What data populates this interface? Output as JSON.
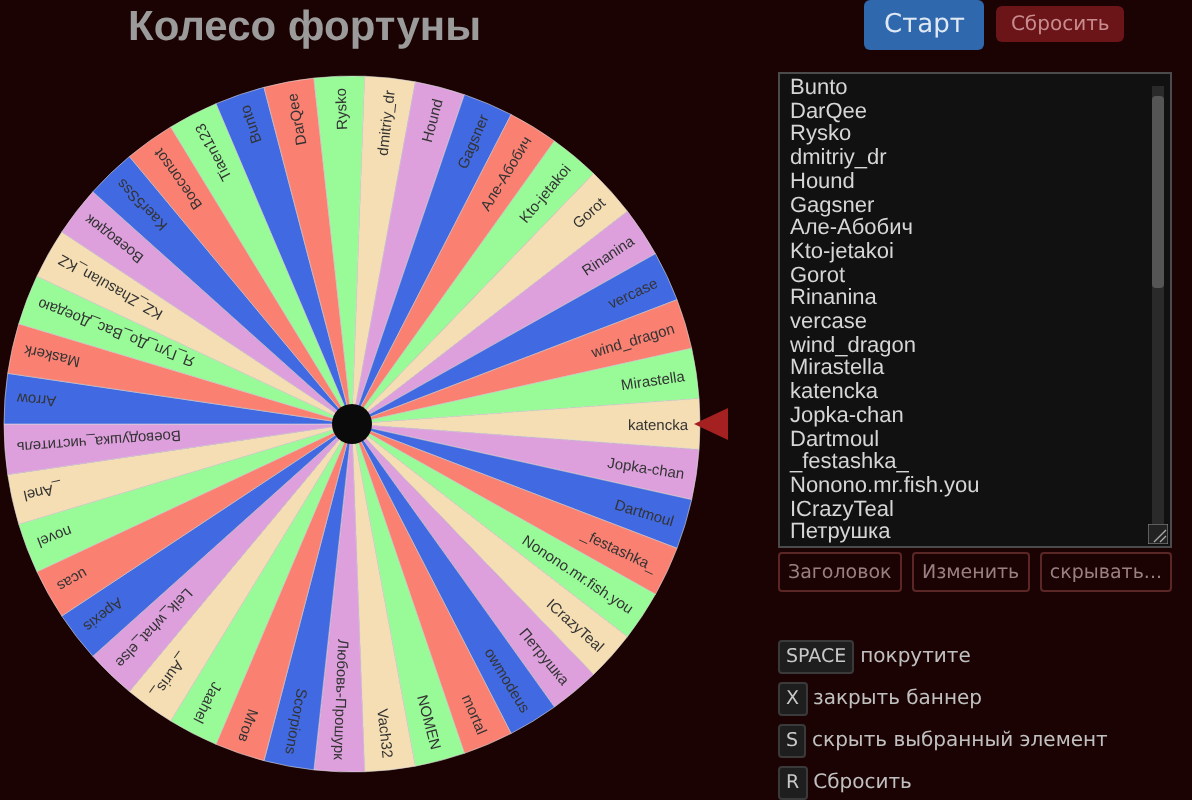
{
  "title": "Колесо фортуны",
  "buttons": [
    {
      "label": "Старт",
      "kind": "primary"
    },
    {
      "label": "Сбросить",
      "kind": "danger"
    }
  ],
  "wheel": {
    "segments": [
      {
        "label": "Bunto"
      },
      {
        "label": "DarQee"
      },
      {
        "label": "Rysko"
      },
      {
        "label": "dmitriy_dr"
      },
      {
        "label": "Hound"
      },
      {
        "label": "Gagsner"
      },
      {
        "label": "Але-Абобич"
      },
      {
        "label": "Kto-jetakoi"
      },
      {
        "label": "Gorot"
      },
      {
        "label": "Rinanina"
      },
      {
        "label": "vercase"
      },
      {
        "label": "wind_dragon"
      },
      {
        "label": "Mirastella"
      },
      {
        "label": "katencka"
      },
      {
        "label": "Jopka-chan"
      },
      {
        "label": "Dartmoul"
      },
      {
        "label": "_festashka_"
      },
      {
        "label": "Nonono.mr.fish.you"
      },
      {
        "label": "ICrazyTeal"
      },
      {
        "label": "Петрушка"
      },
      {
        "label": "owmodeus"
      },
      {
        "label": "mortal"
      },
      {
        "label": "NOMEN"
      },
      {
        "label": "Vach32"
      },
      {
        "label": "Любовь-Прошурк"
      },
      {
        "label": "Scorpions"
      },
      {
        "label": "Mгов"
      },
      {
        "label": "Jaahel"
      },
      {
        "label": "_Auris_"
      },
      {
        "label": "Leik_what_else"
      },
      {
        "label": "Apexis"
      },
      {
        "label": "ucas"
      },
      {
        "label": "novel"
      },
      {
        "label": "_Anel"
      },
      {
        "label": "Воеводушка_чиститель"
      },
      {
        "label": "Arrow"
      },
      {
        "label": "Maskerk"
      },
      {
        "label": "Я_Гуп_До_Вас_Доедаю"
      },
      {
        "label": "KZ_Zhasulan_KZ"
      },
      {
        "label": "Воеводюк"
      },
      {
        "label": "Kaer5Sss"
      },
      {
        "label": "Boeconsot"
      },
      {
        "label": "Tiaen123"
      }
    ]
  },
  "entries": [
    "Bunto",
    "DarQee",
    "Rysko",
    "dmitriy_dr",
    "Hound",
    "Gagsner",
    "Але-Абобич",
    "Kto-jetakoi",
    "Gorot",
    "Rinanina",
    "vercase",
    "wind_dragon",
    "Mirastella",
    "katencka",
    "Jopka-chan",
    "Dartmoul",
    "_festashka_",
    "Nonono.mr.fish.you",
    "ICrazyTeal",
    "Петрушка"
  ],
  "list_buttons": [
    "Заголовок",
    "Изменить",
    "скрывать..."
  ],
  "shortcuts": [
    {
      "key": "SPACE",
      "label": "покрутите"
    },
    {
      "key": "X",
      "label": "закрыть баннер"
    },
    {
      "key": "S",
      "label": "скрыть выбранный элемент"
    },
    {
      "key": "R",
      "label": "Сбросить"
    }
  ]
}
